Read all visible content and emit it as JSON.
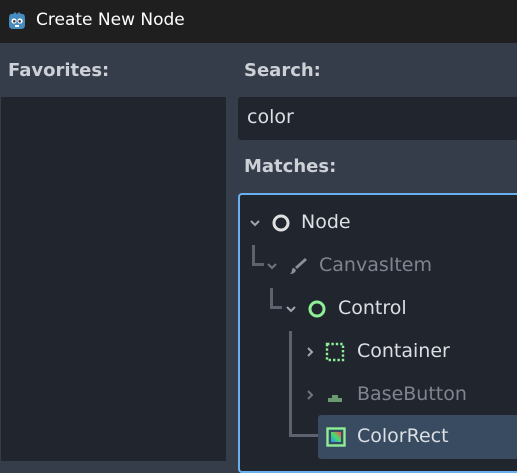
{
  "window": {
    "title": "Create New Node"
  },
  "favorites": {
    "label": "Favorites:"
  },
  "search": {
    "label": "Search:",
    "value": "color"
  },
  "matches": {
    "label": "Matches:",
    "items": [
      {
        "name": "Node",
        "icon": "node-circle-icon",
        "dim": false
      },
      {
        "name": "CanvasItem",
        "icon": "brush-icon",
        "dim": true
      },
      {
        "name": "Control",
        "icon": "control-circle-icon",
        "dim": false
      },
      {
        "name": "Container",
        "icon": "container-icon",
        "dim": false
      },
      {
        "name": "BaseButton",
        "icon": "button-icon",
        "dim": true
      },
      {
        "name": "ColorRect",
        "icon": "color-rect-icon",
        "dim": false,
        "selected": true
      }
    ]
  },
  "colors": {
    "accent": "#6bb0ee",
    "control_green": "#8eef97",
    "selected_bg": "#384b60"
  }
}
